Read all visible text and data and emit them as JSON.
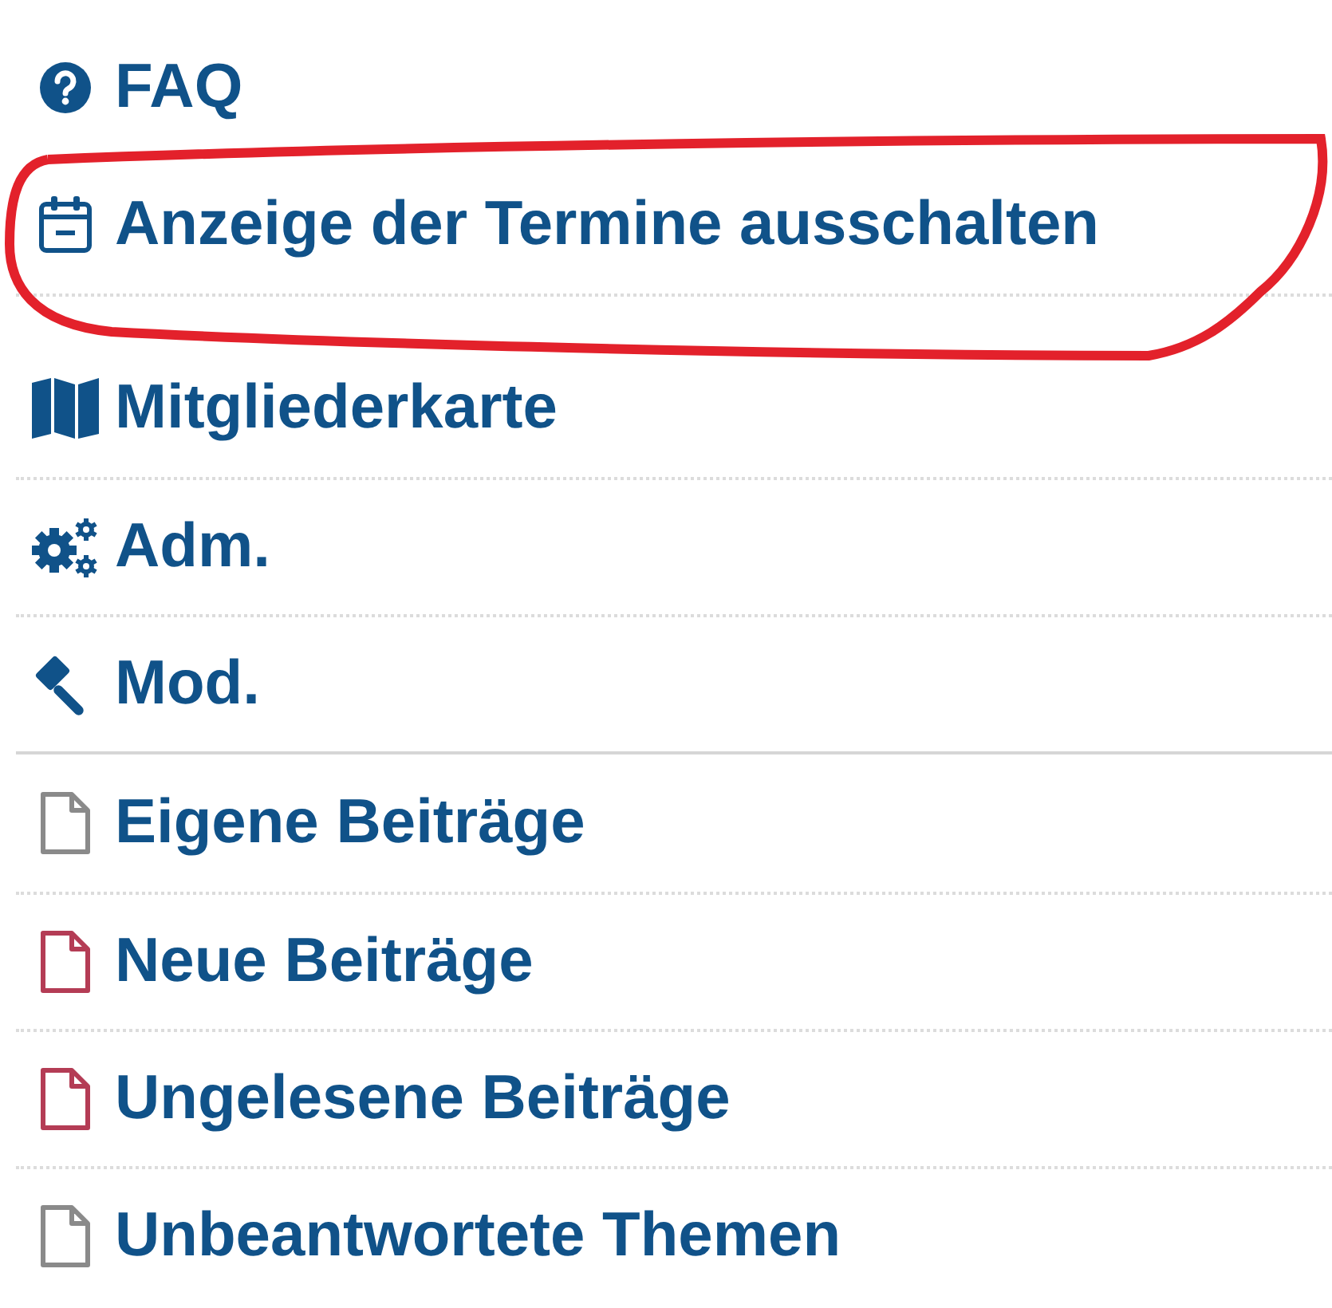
{
  "menu_groups": [
    [
      {
        "label": "FAQ",
        "kind": "question",
        "highlighted": false
      },
      {
        "label": "Anzeige der Termine ausschalten",
        "kind": "calendar",
        "highlighted": true
      },
      {
        "label": "Mitgliederkarte",
        "kind": "map",
        "highlighted": false
      },
      {
        "label": "Adm.",
        "kind": "cogs",
        "highlighted": false
      },
      {
        "label": "Mod.",
        "kind": "gavel",
        "highlighted": false
      }
    ],
    [
      {
        "label": "Eigene Beiträge",
        "kind": "file",
        "unread": false,
        "highlighted": false
      },
      {
        "label": "Neue Beiträge",
        "kind": "file",
        "unread": true,
        "highlighted": false
      },
      {
        "label": "Ungelesene Beiträge",
        "kind": "file",
        "unread": true,
        "highlighted": false
      },
      {
        "label": "Unbeantwortete Themen",
        "kind": "file",
        "unread": false,
        "highlighted": false
      }
    ]
  ]
}
